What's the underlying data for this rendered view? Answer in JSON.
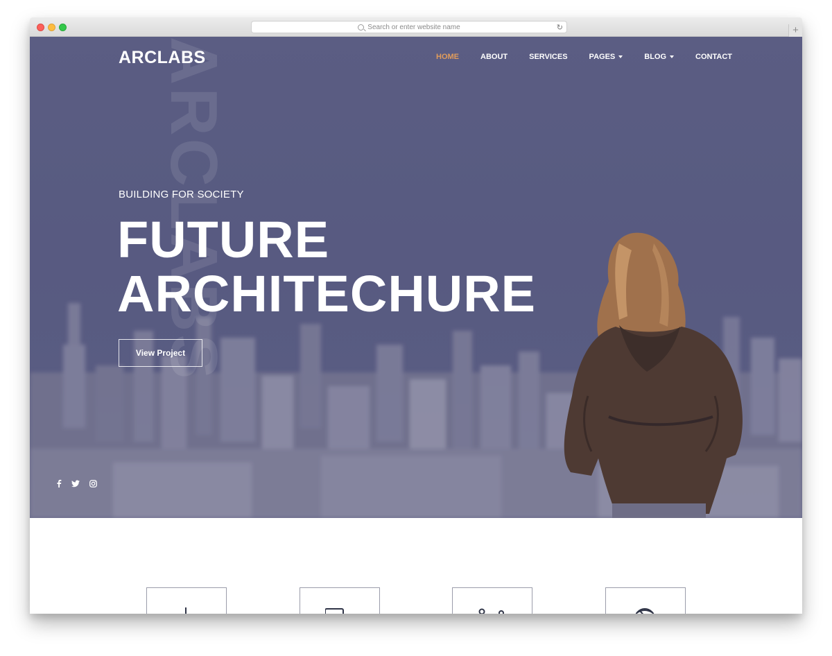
{
  "browser": {
    "url_placeholder": "Search or enter website name"
  },
  "site": {
    "logo": "ARCLABS",
    "watermark": "ARCLABS"
  },
  "nav": {
    "items": [
      {
        "label": "HOME",
        "active": true,
        "dropdown": false
      },
      {
        "label": "ABOUT",
        "active": false,
        "dropdown": false
      },
      {
        "label": "SERVICES",
        "active": false,
        "dropdown": false
      },
      {
        "label": "PAGES",
        "active": false,
        "dropdown": true
      },
      {
        "label": "BLOG",
        "active": false,
        "dropdown": true
      },
      {
        "label": "CONTACT",
        "active": false,
        "dropdown": false
      }
    ]
  },
  "hero": {
    "eyebrow": "BUILDING FOR SOCIETY",
    "title_line1": "FUTURE",
    "title_line2": "ARCHITECHURE",
    "cta": "View Project"
  },
  "social": [
    "facebook-icon",
    "twitter-icon",
    "instagram-icon"
  ],
  "features": [
    "pen-tool-icon",
    "monitor-icon",
    "compass-icon",
    "globe-icon"
  ],
  "colors": {
    "accent": "#e09c5c",
    "hero_overlay": "#5a5c82",
    "text_light": "#ffffff",
    "card_border": "#9a9caa"
  }
}
